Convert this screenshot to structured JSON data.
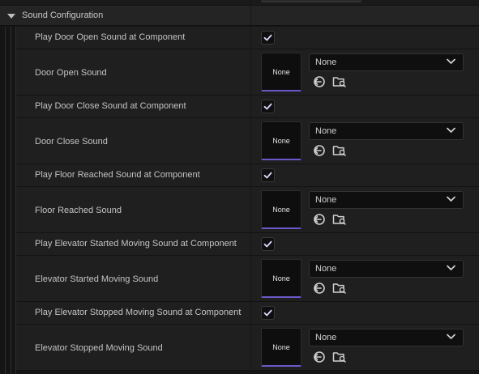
{
  "section": {
    "title": "Sound Configuration"
  },
  "rows": [
    {
      "kind": "check",
      "label": "Play Door Open Sound at Component",
      "checked": true
    },
    {
      "kind": "sound",
      "label": "Door Open Sound",
      "thumb": "None",
      "value": "None"
    },
    {
      "kind": "check",
      "label": "Play Door Close Sound at Component",
      "checked": true
    },
    {
      "kind": "sound",
      "label": "Door Close Sound",
      "thumb": "None",
      "value": "None"
    },
    {
      "kind": "check",
      "label": "Play Floor Reached Sound at Component",
      "checked": true
    },
    {
      "kind": "sound",
      "label": "Floor Reached Sound",
      "thumb": "None",
      "value": "None"
    },
    {
      "kind": "check",
      "label": "Play Elevator Started Moving Sound at Component",
      "checked": true
    },
    {
      "kind": "sound",
      "label": "Elevator Started Moving Sound",
      "thumb": "None",
      "value": "None"
    },
    {
      "kind": "check",
      "label": "Play Elevator Stopped Moving Sound at Component",
      "checked": true
    },
    {
      "kind": "sound",
      "label": "Elevator Stopped Moving Sound",
      "thumb": "None",
      "value": "None"
    }
  ],
  "icons": {
    "expand": "caret-down-icon",
    "check": "checkmark-icon",
    "dropdown": "chevron-down-icon",
    "use_selected": "use-selected-asset-icon",
    "browse": "browse-folder-icon"
  },
  "colors": {
    "accent": "#6c57c9",
    "check": "#d8d8ff"
  }
}
